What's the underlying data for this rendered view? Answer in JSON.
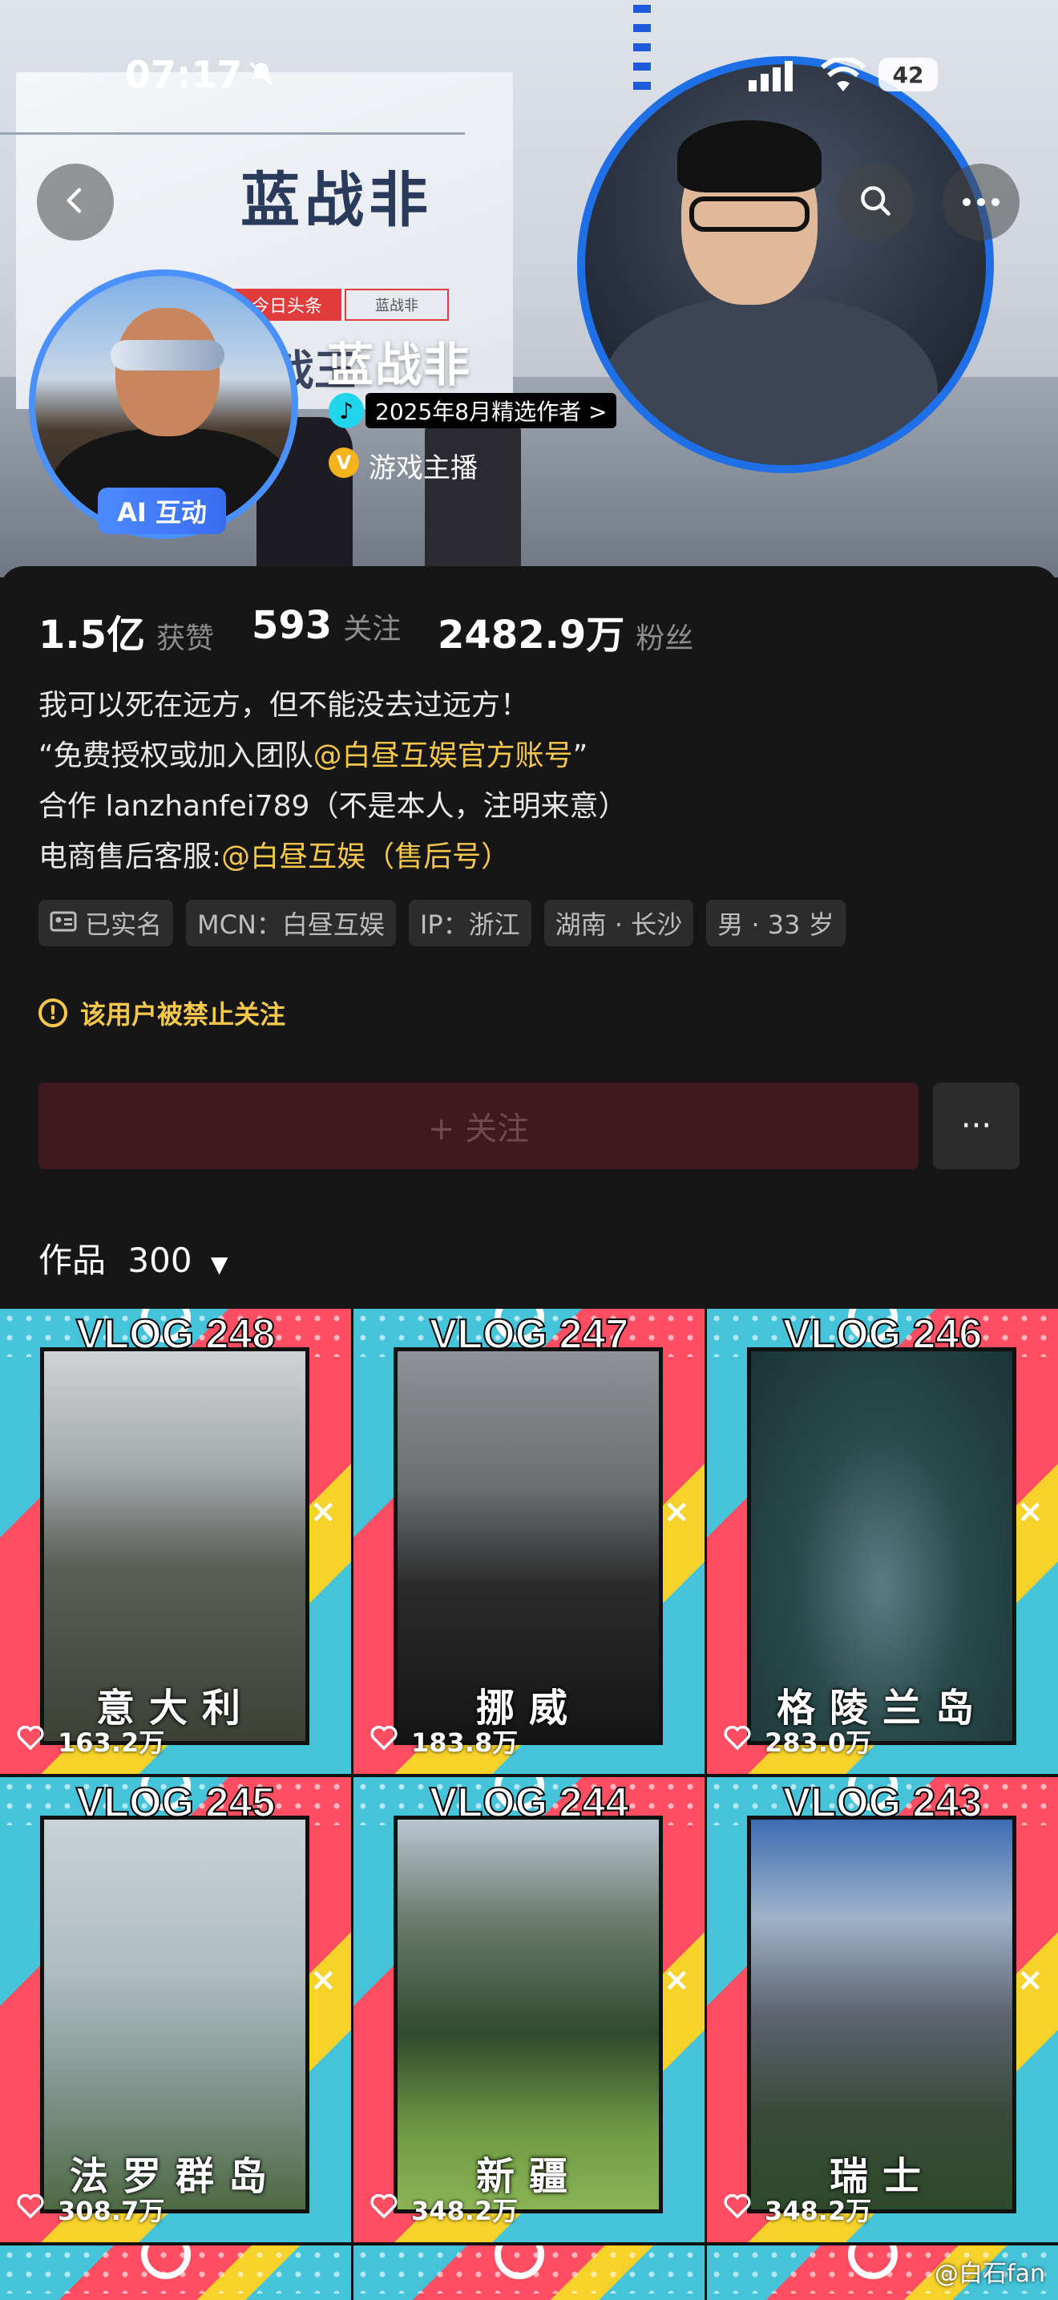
{
  "status_bar": {
    "time": "07:17",
    "battery": "42"
  },
  "banner": {
    "board_title": "蓝战非",
    "board_tag": "今日头条",
    "board_sub": "蓝战非",
    "board_side": "戏王"
  },
  "profile": {
    "name": "蓝战非",
    "ai_badge": "AI 互动",
    "selection_badge": "2025年8月精选作者 >",
    "role": "游戏主播",
    "verify_mark": "V"
  },
  "stats": [
    {
      "value": "1.5亿",
      "label": "获赞"
    },
    {
      "value": "593",
      "label": "关注"
    },
    {
      "value": "2482.9万",
      "label": "粉丝"
    }
  ],
  "bio": {
    "line1": "我可以死在远方，但不能没去过远方！",
    "line2_prefix": "“免费授权或加入团队",
    "line2_link": "@白昼互娱官方账号",
    "line2_suffix": "”",
    "line3": "合作 lanzhanfei789（不是本人，注明来意）",
    "line4_prefix": "电商售后客服:",
    "line4_link": "@白昼互娱（售后号）"
  },
  "tags": [
    "已实名",
    "MCN：白昼互娱",
    "IP：浙江",
    "湖南 · 长沙",
    "男 · 33 岁"
  ],
  "warning": {
    "icon": "!",
    "text": "该用户被禁止关注"
  },
  "follow_button": "+ 关注",
  "more_button": "···",
  "works_tab": {
    "label": "作品",
    "count": "300",
    "caret": "▼"
  },
  "videos": [
    {
      "title": "VLOG 248",
      "location": "意大利",
      "likes": "163.2万"
    },
    {
      "title": "VLOG 247",
      "location": "挪威",
      "likes": "183.8万"
    },
    {
      "title": "VLOG 246",
      "location": "格陵兰岛",
      "likes": "283.0万"
    },
    {
      "title": "VLOG 245",
      "location": "法罗群岛",
      "likes": "308.7万"
    },
    {
      "title": "VLOG 244",
      "location": "新疆",
      "likes": "348.2万"
    },
    {
      "title": "VLOG 243",
      "location": "瑞士",
      "likes": "348.2万"
    }
  ],
  "watermark": "@白石fan",
  "icons": {
    "back": "chevron-left-icon",
    "search": "search-icon",
    "more": "more-icon",
    "heart": "heart-icon"
  }
}
